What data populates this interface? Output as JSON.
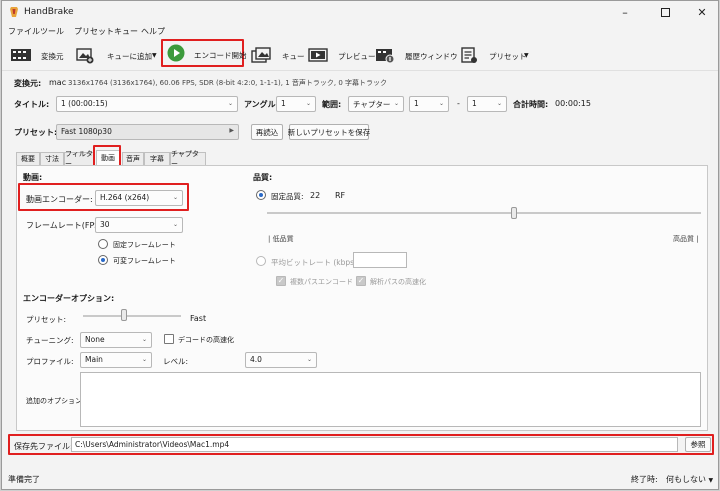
{
  "window": {
    "title": "HandBrake"
  },
  "menu": [
    "ファイル",
    "ツール",
    "プリセット",
    "キュー",
    "ヘルプ"
  ],
  "toolbar": {
    "source": "変換元",
    "add_queue": "キューに追加",
    "start": "エンコード開始",
    "queue": "キュー",
    "preview": "プレビュー",
    "activity": "履歴ウィンドウ",
    "presets": "プリセット"
  },
  "source": {
    "label": "変換元:",
    "name": "mac",
    "info": "3136x1764 (3136x1764), 60.06 FPS, SDR (8-bit 4:2:0, 1-1-1), 1 音声トラック, 0 字幕トラック"
  },
  "title_row": {
    "title_label": "タイトル:",
    "title_value": "1 (00:00:15)",
    "angle_label": "アングル:",
    "angle_value": "1",
    "range_label": "範囲:",
    "range_type": "チャプター",
    "range_from": "1",
    "range_dash": "-",
    "range_to": "1",
    "duration_label": "合計時間:",
    "duration_value": "00:00:15"
  },
  "preset": {
    "label": "プリセット:",
    "value": "Fast 1080p30",
    "reload": "再読込",
    "save_new": "新しいプリセットを保存"
  },
  "tabs": [
    "概要",
    "寸法",
    "フィルター",
    "動画",
    "音声",
    "字幕",
    "チャプター"
  ],
  "video": {
    "section": "動画:",
    "encoder_label": "動画エンコーダー:",
    "encoder_value": "H.264 (x264)",
    "framerate_label": "フレームレート(FPS):",
    "framerate_value": "30",
    "cfr": "固定フレームレート",
    "pfr": "可変フレームレート"
  },
  "quality": {
    "section": "品質:",
    "cq_label": "固定品質:",
    "cq_value": "22",
    "cq_unit": "RF",
    "low": "| 低品質",
    "high": "高品質 |",
    "abr_label": "平均ビットレート (kbps):",
    "multipass": "複数パスエンコード",
    "turbo": "解析パスの高速化",
    "rf_value": 22
  },
  "encoder_options": {
    "section": "エンコーダーオプション:",
    "preset_label": "プリセット:",
    "preset_value": "Fast",
    "tune_label": "チューニング:",
    "tune_value": "None",
    "fast_decode": "デコードの高速化",
    "profile_label": "プロファイル:",
    "profile_value": "Main",
    "level_label": "レベル:",
    "level_value": "4.0",
    "extra_label": "追加のオプション:"
  },
  "destination": {
    "label": "保存先ファイル:",
    "path": "C:\\Users\\Administrator\\Videos\\Mac1.mp4",
    "browse": "参照"
  },
  "status": {
    "left": "準備完了",
    "when_done_label": "終了時:",
    "when_done_value": "何もしない"
  },
  "colors": {
    "highlight": "#e01f1f",
    "accent": "#2a6ac8",
    "start_green": "#3c9a3c"
  }
}
